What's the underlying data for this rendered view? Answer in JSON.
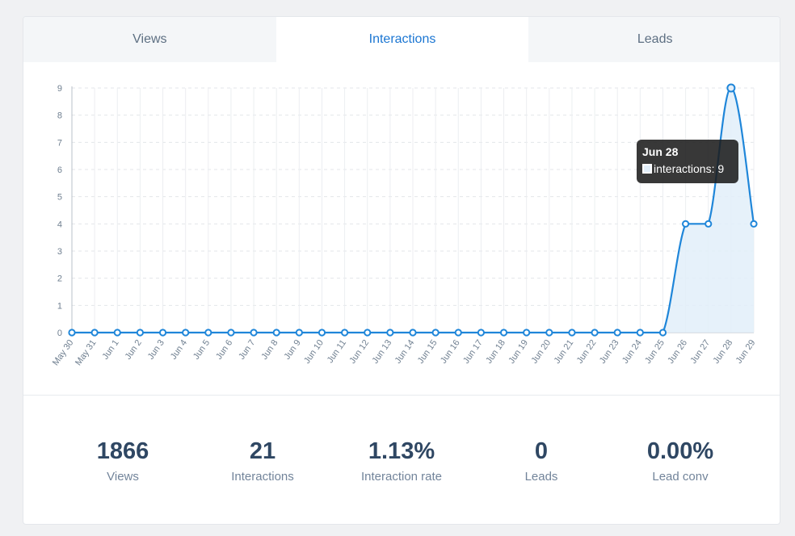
{
  "tabs": [
    {
      "label": "Views",
      "active": false
    },
    {
      "label": "Interactions",
      "active": true
    },
    {
      "label": "Leads",
      "active": false
    }
  ],
  "tooltip": {
    "date": "Jun 28",
    "series_label": "interactions: 9"
  },
  "stats": [
    {
      "value": "1866",
      "label": "Views"
    },
    {
      "value": "21",
      "label": "Interactions"
    },
    {
      "value": "1.13%",
      "label": "Interaction rate"
    },
    {
      "value": "0",
      "label": "Leads"
    },
    {
      "value": "0.00%",
      "label": "Lead conv"
    }
  ],
  "colors": {
    "accent": "#1b76d2",
    "line": "#1f86d9",
    "fill": "#e2eef9",
    "text_dark": "#2f4763",
    "text_muted": "#72849a"
  },
  "chart_data": {
    "type": "area",
    "categories": [
      "May 30",
      "May 31",
      "Jun 1",
      "Jun 2",
      "Jun 3",
      "Jun 4",
      "Jun 5",
      "Jun 6",
      "Jun 7",
      "Jun 8",
      "Jun 9",
      "Jun 10",
      "Jun 11",
      "Jun 12",
      "Jun 13",
      "Jun 14",
      "Jun 15",
      "Jun 16",
      "Jun 17",
      "Jun 18",
      "Jun 19",
      "Jun 20",
      "Jun 21",
      "Jun 22",
      "Jun 23",
      "Jun 24",
      "Jun 25",
      "Jun 26",
      "Jun 27",
      "Jun 28",
      "Jun 29"
    ],
    "series": [
      {
        "values": [
          0,
          0,
          0,
          0,
          0,
          0,
          0,
          0,
          0,
          0,
          0,
          0,
          0,
          0,
          0,
          0,
          0,
          0,
          0,
          0,
          0,
          0,
          0,
          0,
          0,
          0,
          0,
          4,
          4,
          9,
          4
        ]
      }
    ],
    "yticks": [
      0,
      1,
      2,
      3,
      4,
      5,
      6,
      7,
      8,
      9
    ],
    "ylim": [
      0,
      9
    ],
    "grid": true,
    "highlight_index": 29
  }
}
